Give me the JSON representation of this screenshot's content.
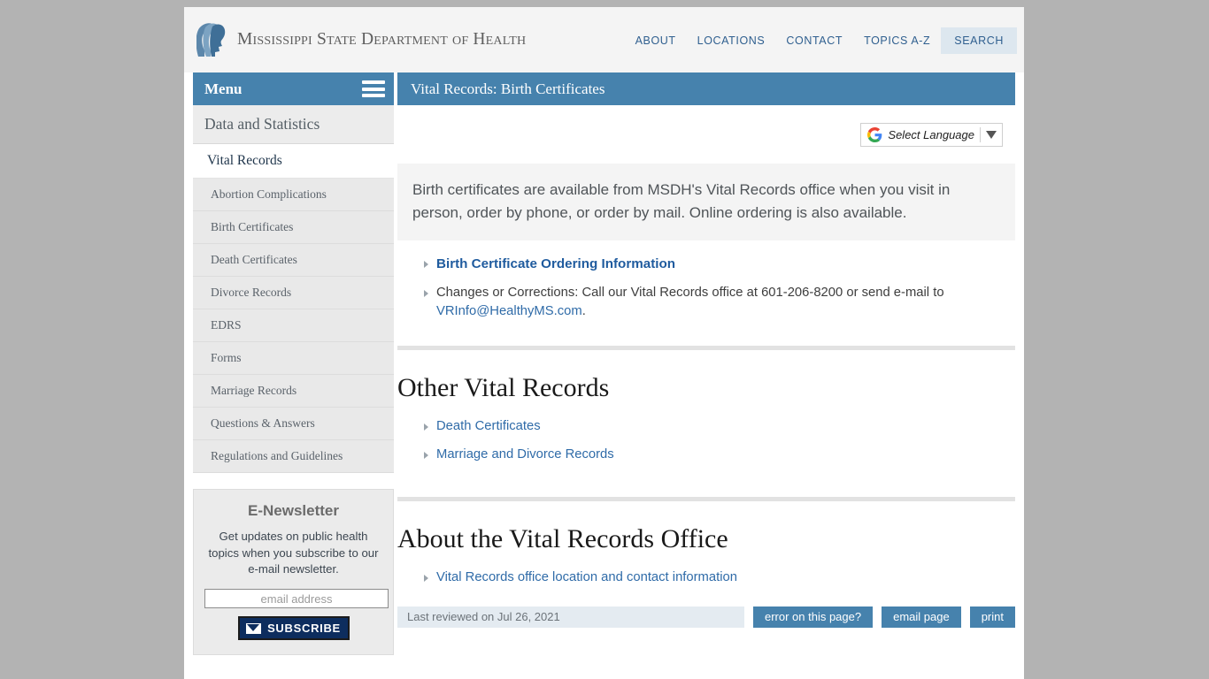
{
  "header": {
    "logo_icon": "msdh-profiles-logo",
    "site_name": "Mississippi State Department of Health",
    "nav": [
      {
        "label": "ABOUT",
        "name": "nav-about"
      },
      {
        "label": "LOCATIONS",
        "name": "nav-locations"
      },
      {
        "label": "CONTACT",
        "name": "nav-contact"
      },
      {
        "label": "TOPICS A-Z",
        "name": "nav-topics-az"
      }
    ],
    "search_label": "SEARCH"
  },
  "sidebar": {
    "menu_label": "Menu",
    "menu_icon": "hamburger-icon",
    "section_heading": "Data and Statistics",
    "items": [
      {
        "label": "Vital Records",
        "active": true
      },
      {
        "label": "Abortion Complications",
        "active": false
      },
      {
        "label": "Birth Certificates",
        "active": false
      },
      {
        "label": "Death Certificates",
        "active": false
      },
      {
        "label": "Divorce Records",
        "active": false
      },
      {
        "label": "EDRS",
        "active": false
      },
      {
        "label": "Forms",
        "active": false
      },
      {
        "label": "Marriage Records",
        "active": false
      },
      {
        "label": "Questions & Answers",
        "active": false
      },
      {
        "label": "Regulations and Guidelines",
        "active": false
      }
    ],
    "newsletter": {
      "title": "E-Newsletter",
      "description": "Get updates on public health topics when you subscribe to our e-mail newsletter.",
      "input_placeholder": "email address",
      "input_value": "",
      "button_label": "SUBSCRIBE",
      "button_icon": "envelope-icon"
    }
  },
  "main": {
    "page_title": "Vital Records: Birth Certificates",
    "translate": {
      "icon": "google-g-icon",
      "label": "Select Language",
      "caret_icon": "chevron-down-icon"
    },
    "intro": "Birth certificates are available from MSDH's Vital Records office when you visit in person, order by phone, or order by mail. Online ordering is also available.",
    "primary_links": [
      {
        "text": "Birth Certificate Ordering Information",
        "strong": true
      },
      {
        "text": "Changes or Corrections: Call our Vital Records office at 601-206-8200 or send e-mail to VRInfo@HealthyMS.com.",
        "strong": false
      }
    ],
    "contact_phone": "601-206-8200",
    "contact_email": "VRInfo@HealthyMS.com",
    "section_other": {
      "heading": "Other Vital Records",
      "links": [
        "Death Certificates",
        "Marriage and Divorce Records"
      ]
    },
    "section_about": {
      "heading": "About the Vital Records Office",
      "links": [
        "Vital Records office location and contact information"
      ]
    }
  },
  "footer": {
    "reviewed": "Last reviewed on Jul 26, 2021",
    "buttons": [
      {
        "label": "error on this page?"
      },
      {
        "label": "email page"
      },
      {
        "label": "print"
      }
    ]
  },
  "colors": {
    "brand_blue": "#4682ad",
    "link_blue": "#2f6ba8",
    "navy": "#0d2d5e",
    "page_bg": "#b3b3b3"
  }
}
